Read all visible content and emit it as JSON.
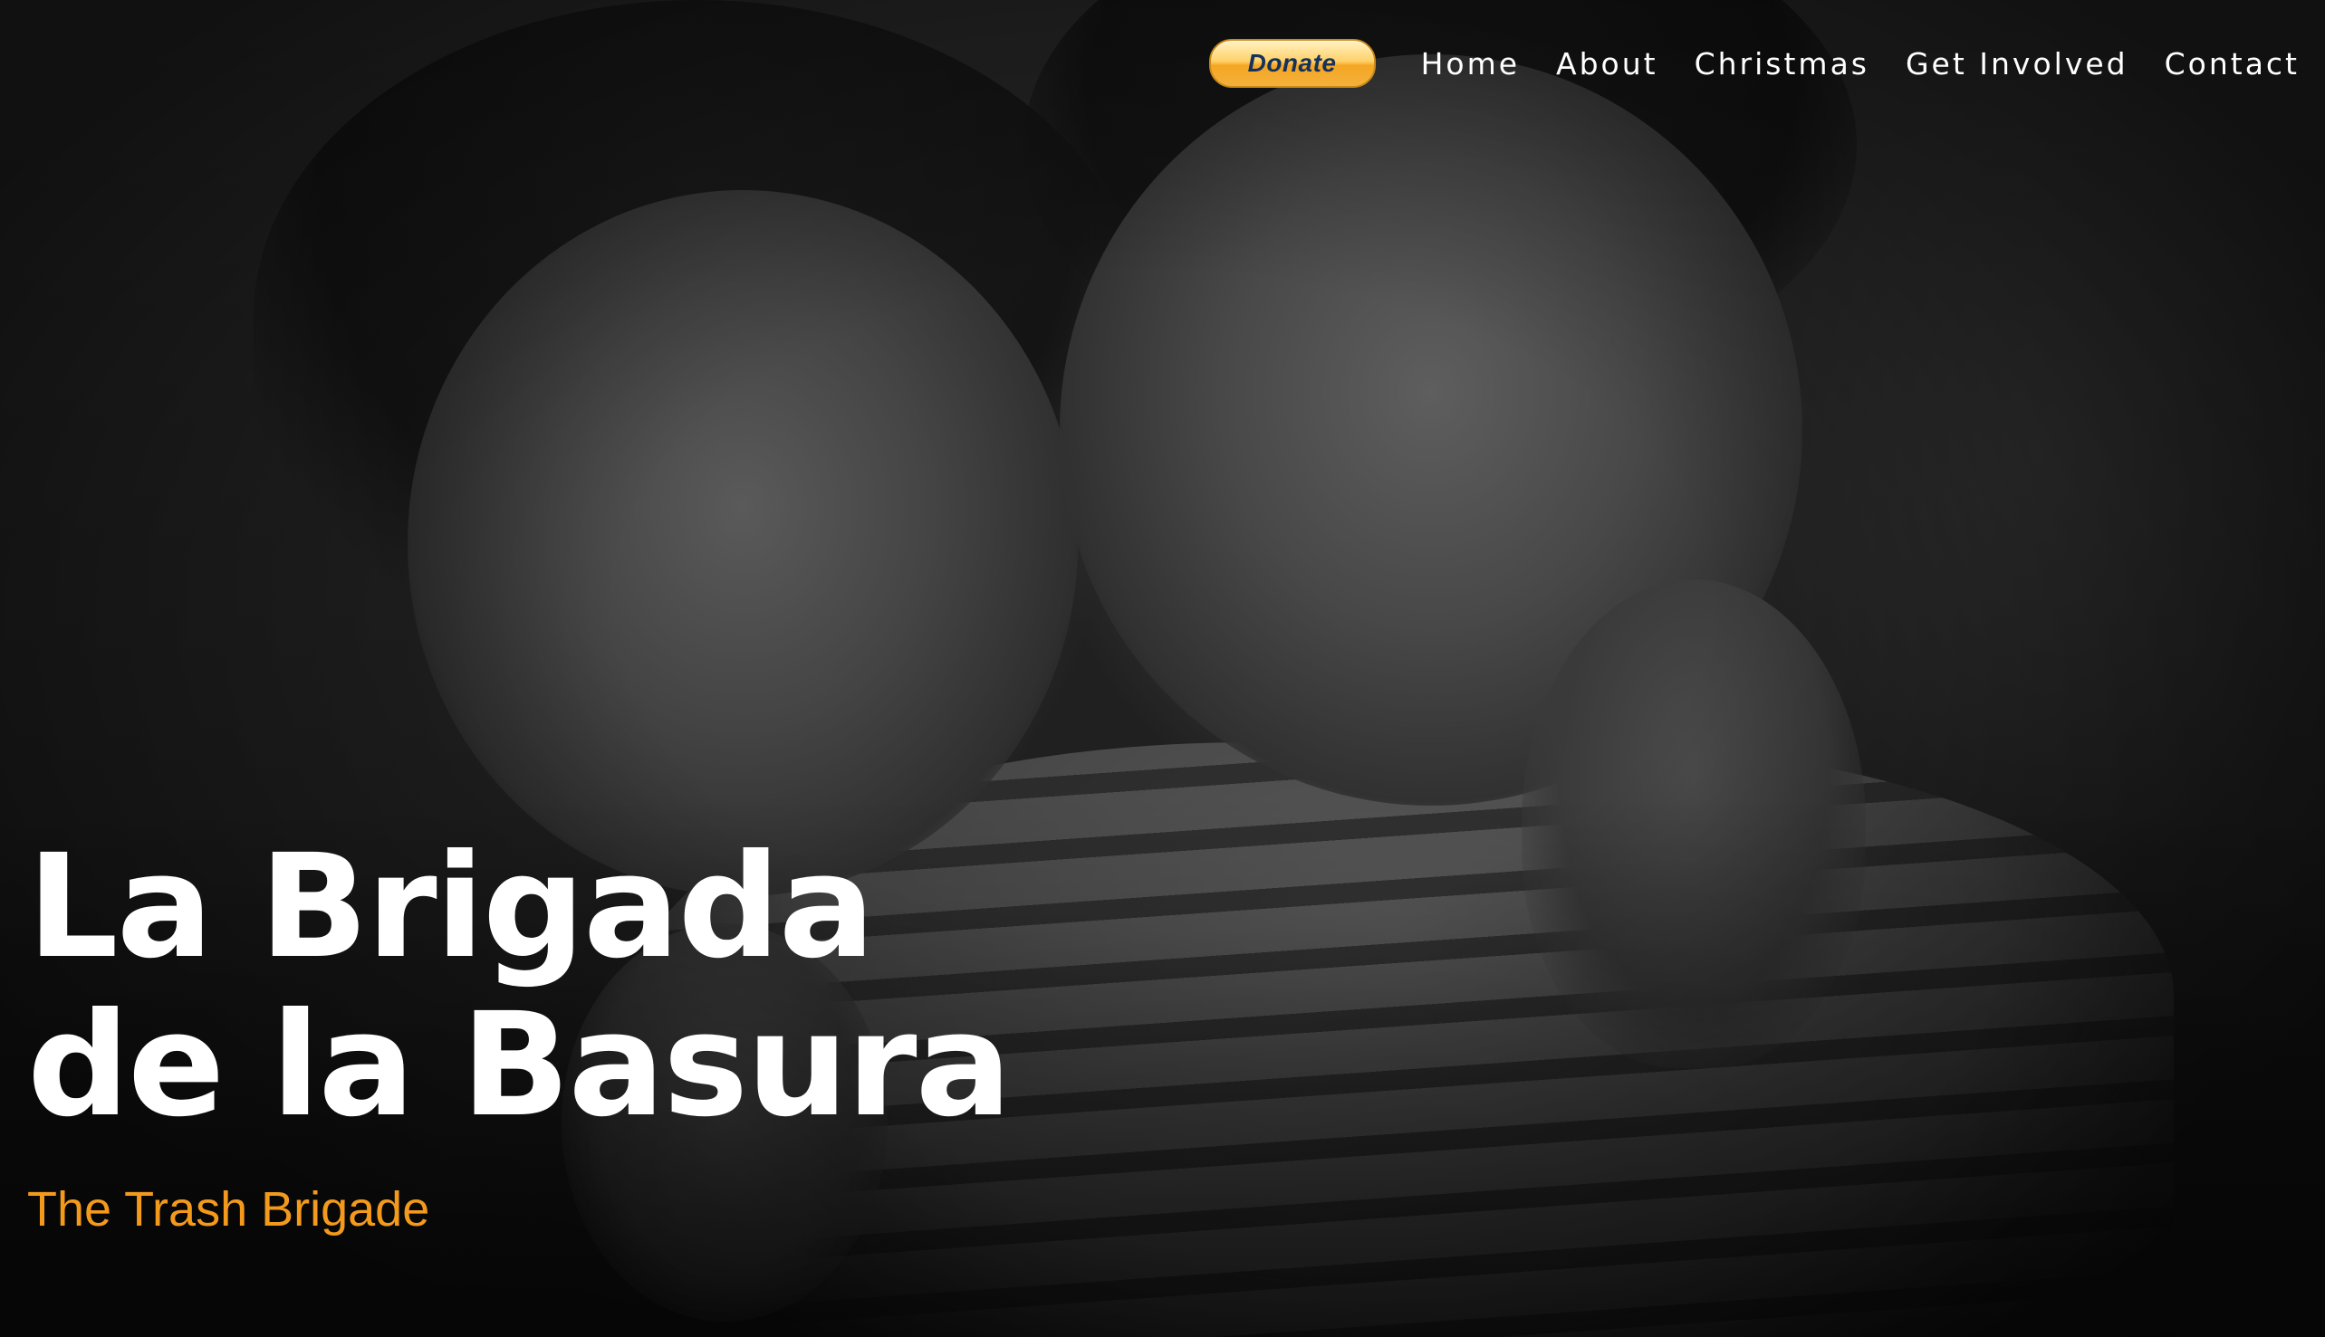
{
  "header": {
    "donate_label": "Donate",
    "nav": [
      "Home",
      "About",
      "Christmas",
      "Get Involved",
      "Contact"
    ]
  },
  "hero": {
    "title_line1": "La Brigada",
    "title_line2": "de la Basura",
    "subtitle": "The Trash Brigade",
    "photo": "black-and-white photo of two smiling children"
  },
  "colors": {
    "subtitle": "#f39a1d",
    "donate_text": "#14325c",
    "donate_fill": "#ffd16a",
    "nav_text": "#ffffff",
    "title_text": "#ffffff"
  }
}
